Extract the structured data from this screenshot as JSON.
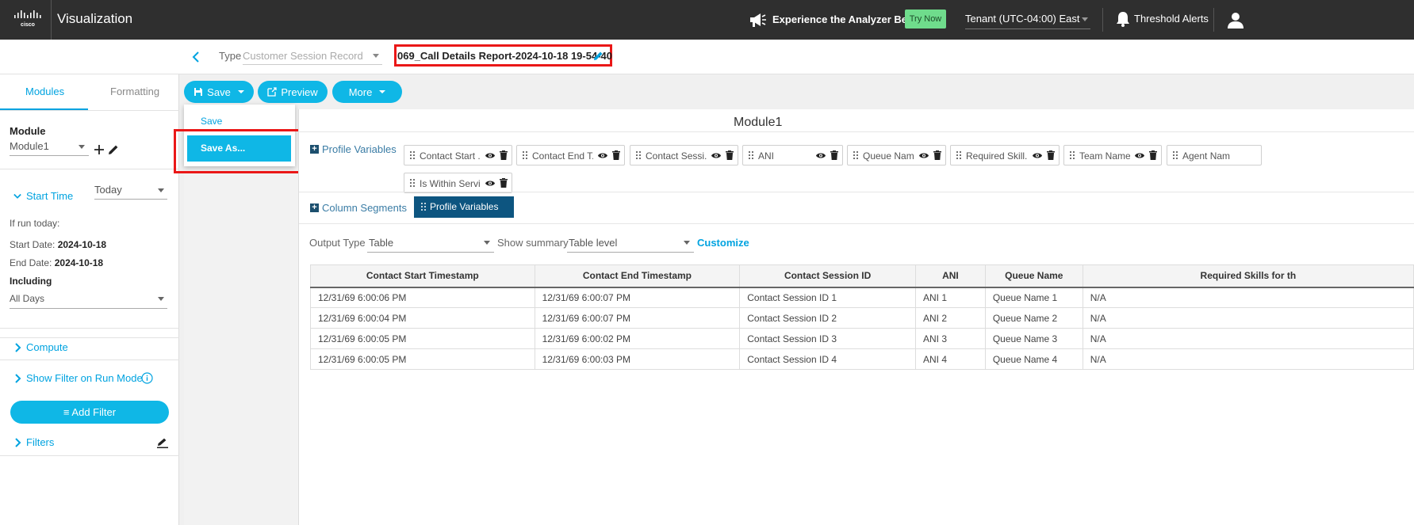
{
  "header": {
    "app_title": "Visualization",
    "promo_text": "Experience the Analyzer Beta",
    "try_now_label": "Try Now",
    "tenant": "Tenant (UTC-04:00) East",
    "threshold_alerts": "Threshold Alerts"
  },
  "subheader": {
    "type_label": "Type",
    "type_value": "Customer Session Record",
    "report_name": "069_Call Details Report-2024-10-18 19-54-40"
  },
  "sidebar": {
    "tabs": [
      "Modules",
      "Formatting"
    ],
    "module_heading": "Module",
    "module_value": "Module1",
    "start_time_label": "Start Time",
    "start_time_value": "Today",
    "if_run_today": "If run today:",
    "start_date_label": "Start Date:",
    "start_date_value": "2024-10-18",
    "end_date_label": "End Date:",
    "end_date_value": "2024-10-18",
    "including_label": "Including",
    "including_value": "All Days",
    "compute_label": "Compute",
    "show_filter_label": "Show Filter on Run Mode",
    "add_filter_label": "Add Filter",
    "filters_label": "Filters"
  },
  "toolbar": {
    "save_label": "Save",
    "preview_label": "Preview",
    "more_label": "More"
  },
  "save_menu": {
    "save": "Save",
    "save_as": "Save As..."
  },
  "module": {
    "title": "Module1",
    "profile_variables_label": "Profile Variables",
    "chips": [
      "Contact Start ...",
      "Contact End T...",
      "Contact Sessi...",
      "ANI",
      "Queue Name",
      "Required Skill...",
      "Team Name",
      "Agent Name",
      "Is Within Servi..."
    ],
    "column_segments_label": "Column Segments",
    "column_segment_chip": "Profile Variables",
    "output_type_label": "Output Type",
    "output_type_value": "Table",
    "show_summary_label": "Show summary",
    "show_summary_value": "Table level",
    "customize_label": "Customize"
  },
  "table": {
    "columns": [
      "Contact Start Timestamp",
      "Contact End Timestamp",
      "Contact Session ID",
      "ANI",
      "Queue Name",
      "Required Skills for th"
    ],
    "rows": [
      [
        "12/31/69 6:00:06 PM",
        "12/31/69 6:00:07 PM",
        "Contact Session ID 1",
        "ANI 1",
        "Queue Name 1",
        "N/A"
      ],
      [
        "12/31/69 6:00:04 PM",
        "12/31/69 6:00:07 PM",
        "Contact Session ID 2",
        "ANI 2",
        "Queue Name 2",
        "N/A"
      ],
      [
        "12/31/69 6:00:05 PM",
        "12/31/69 6:00:02 PM",
        "Contact Session ID 3",
        "ANI 3",
        "Queue Name 3",
        "N/A"
      ],
      [
        "12/31/69 6:00:05 PM",
        "12/31/69 6:00:03 PM",
        "Contact Session ID 4",
        "ANI 4",
        "Queue Name 4",
        "N/A"
      ]
    ]
  },
  "colors": {
    "accent": "#0fb7e6",
    "highlight": "#ea1717",
    "topbar": "#2f2f2f"
  }
}
